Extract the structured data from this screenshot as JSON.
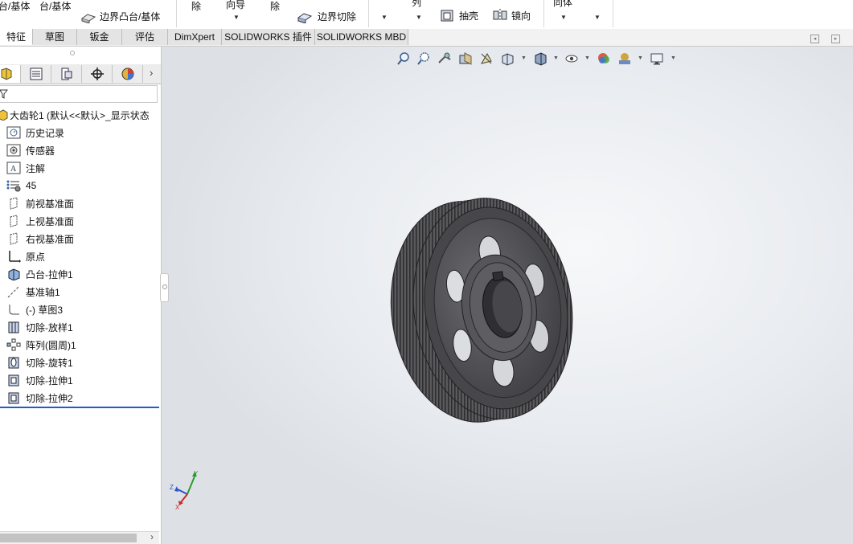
{
  "ribbon": {
    "text1": "台/基体",
    "text2": "台/基体",
    "boundary_boss": "边界凸台/基体",
    "cut_fragment1": "除",
    "fragment_xiang": "向导",
    "cut_fragment2": "除",
    "boundary_cut": "边界切除",
    "fragment_lie": "列",
    "shell": "抽壳",
    "mirror": "镜向",
    "fragment_body": "同体"
  },
  "tabs": [
    {
      "label": "特征",
      "active": true
    },
    {
      "label": "草图"
    },
    {
      "label": "钣金"
    },
    {
      "label": "评估"
    },
    {
      "label": "DimXpert"
    },
    {
      "label": "SOLIDWORKS 插件"
    },
    {
      "label": "SOLIDWORKS MBD"
    }
  ],
  "tree": {
    "root": "大齿轮1 (默认<<默认>_显示状态",
    "items": [
      {
        "label": "历史记录",
        "icon": "history-icon"
      },
      {
        "label": "传感器",
        "icon": "sensor-icon"
      },
      {
        "label": "注解",
        "icon": "annotation-icon"
      },
      {
        "label": "45",
        "icon": "material-icon"
      },
      {
        "label": "前视基准面",
        "icon": "plane-icon"
      },
      {
        "label": "上视基准面",
        "icon": "plane-icon"
      },
      {
        "label": "右视基准面",
        "icon": "plane-icon"
      },
      {
        "label": "原点",
        "icon": "origin-icon"
      },
      {
        "label": "凸台-拉伸1",
        "icon": "extrude-icon"
      },
      {
        "label": "基准轴1",
        "icon": "axis-icon"
      },
      {
        "label": "(-) 草图3",
        "icon": "sketch-icon"
      },
      {
        "label": "切除-放样1",
        "icon": "cut-loft-icon"
      },
      {
        "label": "阵列(圆周)1",
        "icon": "circular-pattern-icon"
      },
      {
        "label": "切除-旋转1",
        "icon": "cut-revolve-icon"
      },
      {
        "label": "切除-拉伸1",
        "icon": "cut-extrude-icon"
      },
      {
        "label": "切除-拉伸2",
        "icon": "cut-extrude-icon"
      }
    ]
  },
  "triad": {
    "x": "X",
    "y": "Y",
    "z": "Z"
  },
  "colors": {
    "accent": "#1f5fbf",
    "gear": "#4a4a4e"
  }
}
